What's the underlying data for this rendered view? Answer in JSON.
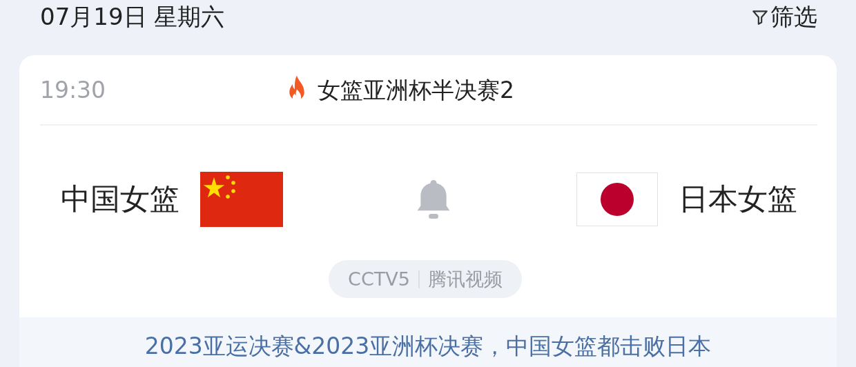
{
  "header": {
    "date": "07月19日 星期六",
    "filter_label": "筛选"
  },
  "match": {
    "time": "19:30",
    "title": "女篮亚洲杯半决赛2",
    "home": {
      "name": "中国女篮"
    },
    "away": {
      "name": "日本女篮"
    },
    "channels": [
      "CCTV5",
      "腾讯视频"
    ],
    "note": "2023亚运决赛&2023亚洲杯决赛，中国女篮都击败日本"
  }
}
